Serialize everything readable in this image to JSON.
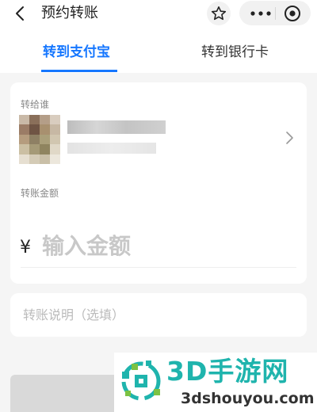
{
  "header": {
    "title": "预约转账",
    "back_icon": "back-arrow-icon",
    "star_icon": "star-icon",
    "more_icon": "more-dots-icon",
    "target_icon": "target-icon"
  },
  "tabs": [
    {
      "label": "转到支付宝",
      "active": true
    },
    {
      "label": "转到银行卡",
      "active": false
    }
  ],
  "recipient": {
    "label": "转给谁",
    "avatar_icon": "avatar-blurred",
    "name_redacted": true,
    "chevron_icon": "chevron-right-icon"
  },
  "amount": {
    "label": "转账金额",
    "currency_symbol": "¥",
    "placeholder": "输入金额",
    "value": ""
  },
  "note": {
    "placeholder": "转账说明（选填）",
    "value": ""
  },
  "watermark": {
    "title": "3D手游网",
    "subtitle": "3dshouyou.com",
    "logo_icon": "3dshouyou-logo"
  },
  "colors": {
    "accent": "#1677ff",
    "watermark_green": "#1fb4ad"
  }
}
